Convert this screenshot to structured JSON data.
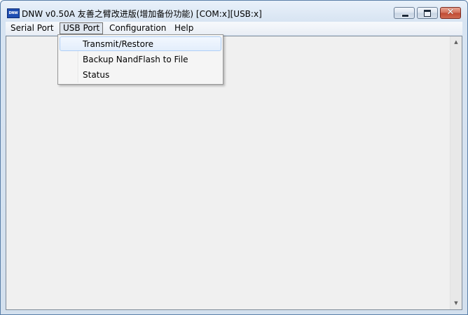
{
  "window": {
    "title": "DNW v0.50A 友善之臂改进版(增加备份功能)    [COM:x][USB:x]",
    "icon_label": "DNW",
    "caption_buttons": {
      "minimize_icon": "minimize-icon",
      "maximize_icon": "maximize-icon",
      "close_icon": "close-icon",
      "close_glyph": "✕"
    },
    "colors": {
      "close_button": "#c94a32",
      "client_background": "#f0f0f0",
      "menu_highlight": "#aecff7"
    }
  },
  "menubar": {
    "items": [
      {
        "label": "Serial Port"
      },
      {
        "label": "USB Port"
      },
      {
        "label": "Configuration"
      },
      {
        "label": "Help"
      }
    ],
    "open_menu": "USB Port"
  },
  "usb_menu": {
    "items": [
      {
        "label": "Transmit/Restore"
      },
      {
        "label": "Backup NandFlash to File"
      },
      {
        "label": "Status"
      }
    ],
    "highlighted": "Transmit/Restore"
  },
  "scrollbar": {
    "up_glyph": "▲",
    "down_glyph": "▼"
  }
}
